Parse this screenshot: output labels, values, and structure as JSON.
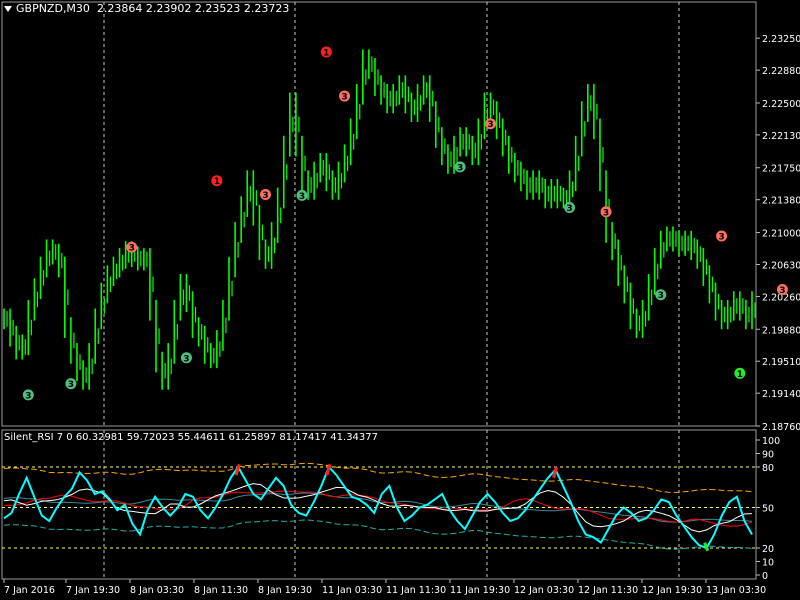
{
  "header": {
    "symbol": "GBPNZD,M30",
    "ohlc": "2.23864 2.23902 2.23523 2.23723"
  },
  "indicator": {
    "label": "Silent_RSI 7 0 60.32981 59.72023 55.44611 61.25897 81.17417 41.34377"
  },
  "colors": {
    "background": "#000000",
    "candle": "#00ff00",
    "rsi_line": "#00ffff",
    "upper_band": "#ffa500",
    "lower_band": "#20b2aa",
    "ma_red": "#ff0000",
    "ma_white": "#ffffff",
    "level_lines": "#ffff66",
    "grid": "#c8c8c8"
  },
  "chart_data": [
    {
      "type": "line",
      "title": "GBPNZD,M30",
      "y_ticks": [
        "2.23250",
        "2.22880",
        "2.22500",
        "2.22130",
        "2.21750",
        "2.21380",
        "2.21000",
        "2.20630",
        "2.20260",
        "2.19880",
        "2.19510",
        "2.19140",
        "2.18760"
      ],
      "y_values": [
        2.2325,
        2.2288,
        2.225,
        2.2213,
        2.2175,
        2.2138,
        2.21,
        2.2063,
        2.2026,
        2.1988,
        2.1951,
        2.1914,
        2.1876
      ],
      "ylim": [
        2.1876,
        2.2353
      ],
      "x_ticks": [
        "7 Jan 2016",
        "7 Jan 19:30",
        "8 Jan 03:30",
        "8 Jan 11:30",
        "8 Jan 19:30",
        "11 Jan 03:30",
        "11 Jan 11:30",
        "11 Jan 19:30",
        "12 Jan 03:30",
        "12 Jan 11:30",
        "12 Jan 19:30",
        "13 Jan 03:30"
      ],
      "series": [
        {
          "values": [
            2.2,
            2.198,
            2.1965,
            2.197,
            2.201,
            2.2035,
            2.206,
            2.208,
            2.2075,
            2.206,
            2.199,
            2.196,
            2.194,
            2.193,
            2.196,
            2.2,
            2.203,
            2.205,
            2.206,
            2.207,
            2.2078,
            2.2072,
            2.2068,
            2.207,
            2.201,
            2.195,
            2.193,
            2.196,
            2.201,
            2.204,
            2.202,
            2.199,
            2.198,
            2.196,
            2.1955,
            2.1975,
            2.201,
            2.206,
            2.21,
            2.213,
            2.216,
            2.212,
            2.208,
            2.207,
            2.21,
            2.214,
            2.22,
            2.225,
            2.22,
            2.216,
            2.215,
            2.217,
            2.218,
            2.216,
            2.215,
            2.217,
            2.219,
            2.222,
            2.226,
            2.23,
            2.229,
            2.227,
            2.226,
            2.225,
            2.226,
            2.227,
            2.225,
            2.224,
            2.226,
            2.227,
            2.224,
            2.221,
            2.219,
            2.218,
            2.22,
            2.221,
            2.22,
            2.219,
            2.222,
            2.225,
            2.224,
            2.222,
            2.22,
            2.218,
            2.217,
            2.216,
            2.215,
            2.216,
            2.215,
            2.214,
            2.215,
            2.214,
            2.214,
            2.216,
            2.22,
            2.224,
            2.226,
            2.222,
            2.216,
            2.21,
            2.208,
            2.205,
            2.203,
            2.2,
            2.199,
            2.201,
            2.204,
            2.207,
            2.209,
            2.2095,
            2.209,
            2.2085,
            2.209,
            2.208,
            2.207,
            2.205,
            2.203,
            2.201,
            2.2,
            2.201,
            2.202,
            2.201,
            2.2,
            2.202
          ]
        },
        {
          "name": "Silent_RSI",
          "values": [
            42,
            46,
            60,
            72,
            58,
            44,
            40,
            50,
            58,
            64,
            76,
            70,
            60,
            62,
            56,
            48,
            52,
            38,
            30,
            48,
            58,
            50,
            44,
            50,
            60,
            58,
            48,
            42,
            50,
            60,
            72,
            80,
            70,
            60,
            56,
            64,
            72,
            66,
            52,
            46,
            44,
            54,
            66,
            80,
            74,
            66,
            58,
            56,
            52,
            46,
            60,
            66,
            50,
            40,
            44,
            50,
            52,
            56,
            60,
            48,
            40,
            34,
            44,
            54,
            60,
            54,
            46,
            40,
            42,
            48,
            56,
            64,
            72,
            78,
            66,
            54,
            40,
            30,
            28,
            24,
            34,
            44,
            50,
            46,
            40,
            42,
            48,
            56,
            54,
            44,
            36,
            28,
            22,
            20,
            30,
            44,
            54,
            58,
            40,
            30
          ]
        }
      ],
      "subwindow": {
        "y_ticks": [
          "100",
          "90",
          "80",
          "50",
          "20",
          "10",
          "0"
        ],
        "y_values": [
          100,
          90,
          80,
          50,
          20,
          10,
          0
        ],
        "ylim": [
          0,
          100
        ]
      },
      "signals": [
        {
          "text": "3",
          "color": "#4fbf80",
          "index": 4,
          "price": 2.1912
        },
        {
          "text": "3",
          "color": "#4fbf80",
          "index": 11,
          "price": 2.1925
        },
        {
          "text": "3",
          "color": "#ff7060",
          "index": 21,
          "price": 2.2083
        },
        {
          "text": "3",
          "color": "#4fbf80",
          "index": 30,
          "price": 2.1955
        },
        {
          "text": "1",
          "color": "#ff2020",
          "index": 35,
          "price": 2.216
        },
        {
          "text": "3",
          "color": "#ff7060",
          "index": 43,
          "price": 2.2144
        },
        {
          "text": "3",
          "color": "#4fbf80",
          "index": 49,
          "price": 2.2143
        },
        {
          "text": "1",
          "color": "#ff2020",
          "index": 53,
          "price": 2.2309
        },
        {
          "text": "3",
          "color": "#ff7060",
          "index": 56,
          "price": 2.2258
        },
        {
          "text": "3",
          "color": "#4fbf80",
          "index": 75,
          "price": 2.2176
        },
        {
          "text": "3",
          "color": "#ff7060",
          "index": 80,
          "price": 2.2226
        },
        {
          "text": "3",
          "color": "#4fbf80",
          "index": 93,
          "price": 2.2129
        },
        {
          "text": "3",
          "color": "#ff7060",
          "index": 99,
          "price": 2.2124
        },
        {
          "text": "3",
          "color": "#4fbf80",
          "index": 108,
          "price": 2.2028
        },
        {
          "text": "3",
          "color": "#ff7060",
          "index": 118,
          "price": 2.2096
        },
        {
          "text": "1",
          "color": "#22ee22",
          "index": 121,
          "price": 2.1937
        },
        {
          "text": "3",
          "color": "#ff7060",
          "index": 128,
          "price": 2.2034
        }
      ]
    }
  ]
}
